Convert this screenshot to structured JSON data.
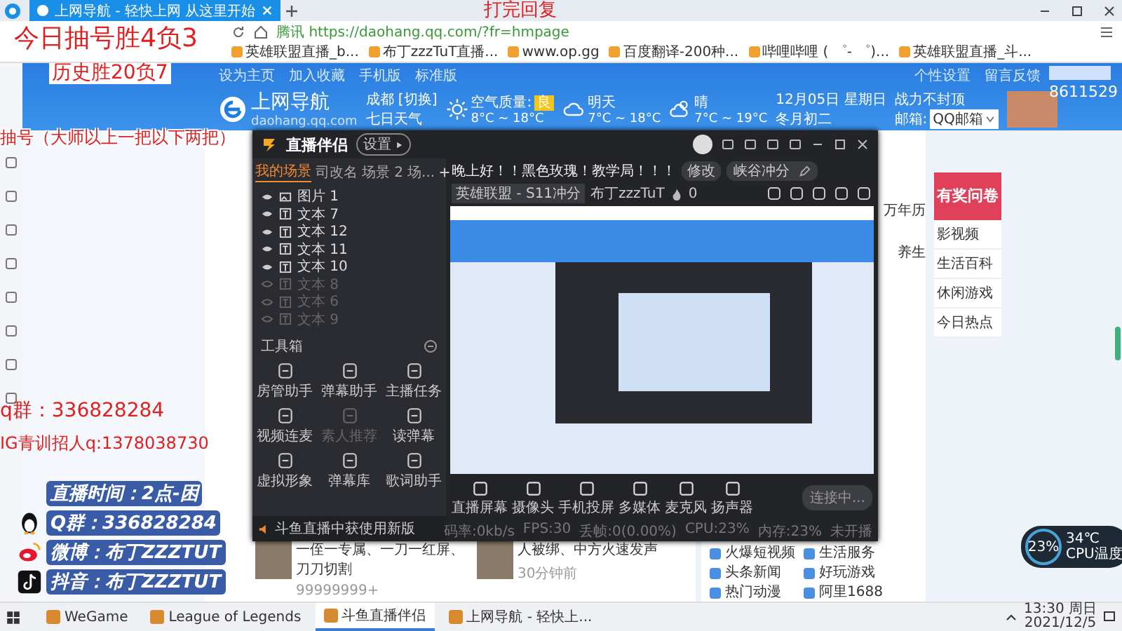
{
  "browser": {
    "tab_title": "上网导航 - 轻快上网 从这里开始",
    "url_prefix": "腾讯",
    "url": "https://daohang.qq.com/?fr=hmpage",
    "bookmarks": [
      "英雄联盟直播_b...",
      "布丁zzzTuT直播...",
      "www.op.gg",
      "百度翻译-200种...",
      "哔哩哔哩 ( ゜- ゜)...",
      "英雄联盟直播_斗..."
    ]
  },
  "page": {
    "top_links": [
      "设为主页",
      "加入收藏",
      "手机版",
      "标准版"
    ],
    "logo": "上网导航",
    "logo_domain": "daohang.qq.com",
    "city": "成都 [切换]",
    "city_note": "七日天气",
    "weather": [
      {
        "kind": "sun",
        "label": "空气质量:",
        "badge": "良",
        "temp": "8°C ~ 18°C"
      },
      {
        "kind": "cloud",
        "label": "明天",
        "temp": "7°C ~ 18°C"
      },
      {
        "kind": "partly",
        "label": "晴",
        "temp": "7°C ~ 19°C"
      }
    ],
    "date": "12月05日 星期日",
    "lunar": "冬月初二",
    "slogan": "战力不封顶",
    "mail_label": "邮箱:",
    "mail_value": "QQ邮箱",
    "right_links": [
      "个性设置",
      "留言反馈"
    ],
    "number": "8611529",
    "side_items": [
      "万年历",
      "养生"
    ],
    "ad_title": "有奖问卷",
    "ad_links": [
      "影视频",
      "生活百科",
      "休闲游戏",
      "今日热点"
    ],
    "news": [
      {
        "title": "一侄一专属、一刀一红屏、刀刀切割",
        "meta": "99999999+"
      },
      {
        "title": "人被绑、中方火速发声",
        "meta": "30分钟前"
      }
    ],
    "services": [
      "火爆短视频",
      "生活服务",
      "头条新闻",
      "好玩游戏",
      "热门动漫",
      "阿里1688"
    ]
  },
  "app": {
    "title": "直播伴侣",
    "badge": "设置",
    "scene_tabs": [
      {
        "label": "我的场景",
        "selected": true
      },
      {
        "label": "司改名",
        "selected": false
      },
      {
        "label": "场景 2",
        "selected": false
      },
      {
        "label": "场...",
        "selected": false
      }
    ],
    "sources": [
      {
        "name": "图片 1",
        "kind": "image",
        "visible": true
      },
      {
        "name": "文本 7",
        "kind": "text",
        "visible": true
      },
      {
        "name": "文本 12",
        "kind": "text",
        "visible": true
      },
      {
        "name": "文本 11",
        "kind": "text",
        "visible": true
      },
      {
        "name": "文本 10",
        "kind": "text",
        "visible": true
      },
      {
        "name": "文本 8",
        "kind": "text",
        "visible": false
      },
      {
        "name": "文本 6",
        "kind": "text",
        "visible": false
      },
      {
        "name": "文本 9",
        "kind": "text",
        "visible": false
      }
    ],
    "toolbox_title": "工具箱",
    "tools": [
      {
        "label": "房管助手",
        "disabled": false
      },
      {
        "label": "弹幕助手",
        "disabled": false
      },
      {
        "label": "主播任务",
        "disabled": false
      },
      {
        "label": "视频连麦",
        "disabled": false
      },
      {
        "label": "素人推荐",
        "disabled": true
      },
      {
        "label": "读弹幕",
        "disabled": false
      },
      {
        "label": "虚拟形象",
        "disabled": false
      },
      {
        "label": "弹幕库",
        "disabled": false
      },
      {
        "label": "歌词助手",
        "disabled": false
      }
    ],
    "notice": "斗鱼直播中获使用新版",
    "stream_title": "晚上好！！黑色玫瑰！教学局！！！",
    "title_button": "修改",
    "category": "峡谷冲分",
    "game_tag": "英雄联盟 - S11冲分",
    "streamer": "布丁zzzTuT",
    "heat": "0",
    "inputs": [
      "直播屏幕",
      "摄像头",
      "手机投屏",
      "多媒体",
      "麦克风",
      "扬声器"
    ],
    "start_button": "连接中...",
    "status": [
      "码率:0kb/s",
      "FPS:30",
      "丢帧:0(0.00%)",
      "CPU:23%",
      "内存:23%",
      "未开播"
    ]
  },
  "overlay": {
    "red_top": "打完回复",
    "red_lines": [
      "今日抽号胜4负3",
      "历史胜20负7",
      "抽号（大师以上一把以下两把）"
    ],
    "red_bottom": [
      "q群：336828284",
      "IG青训招人q:1378038730"
    ],
    "info": [
      {
        "kind": "none",
        "text": "直播时间：2点-困"
      },
      {
        "kind": "qq",
        "text": "Q群：336828284"
      },
      {
        "kind": "weibo",
        "text": "微博：布丁ZZZTUT"
      },
      {
        "kind": "douyin",
        "text": "抖音：布丁ZZZTUT"
      }
    ]
  },
  "widget": {
    "cpu": "23%",
    "temp": "34℃",
    "label": "CPU温度"
  },
  "taskbar": {
    "items": [
      {
        "label": "WeGame",
        "selected": false
      },
      {
        "label": "League of Legends",
        "selected": false
      },
      {
        "label": "斗鱼直播伴侣",
        "selected": true
      },
      {
        "label": "上网导航 - 轻快上...",
        "selected": false
      }
    ],
    "time": "13:30 周日",
    "date": "2021/12/5"
  }
}
